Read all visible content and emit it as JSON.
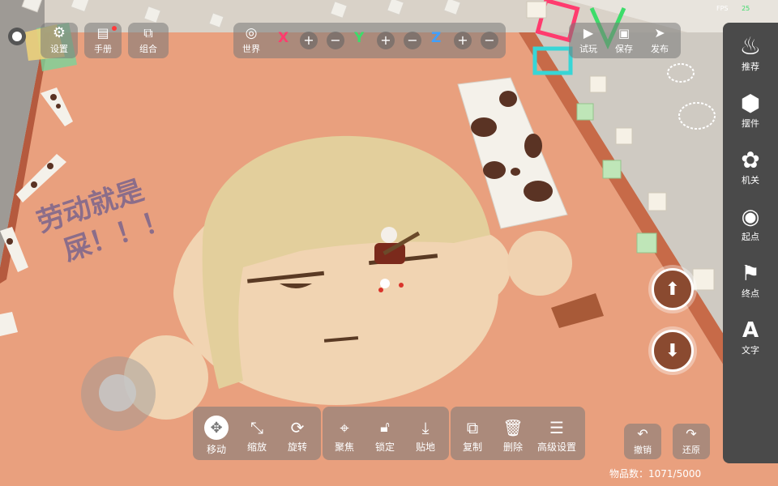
{
  "top_bar": {
    "settings": "设置",
    "manual": "手册",
    "combine": "组合",
    "world": "世界",
    "axis_x": "X",
    "axis_y": "Y",
    "axis_z": "Z",
    "plus": "+",
    "minus": "−",
    "test_play": "试玩",
    "save": "保存",
    "publish": "发布",
    "fps_label": "FPS",
    "fps_value": "25"
  },
  "sidebar": {
    "items": [
      {
        "label": "推荐",
        "icon": "fire-icon"
      },
      {
        "label": "摆件",
        "icon": "cube-icon"
      },
      {
        "label": "机关",
        "icon": "gear-icon"
      },
      {
        "label": "起点",
        "icon": "map-pin-icon"
      },
      {
        "label": "终点",
        "icon": "flag-icon"
      },
      {
        "label": "文字",
        "icon": "text-icon"
      }
    ]
  },
  "bottom_toolbar": {
    "move": "移动",
    "scale": "缩放",
    "rotate": "旋转",
    "focus": "聚焦",
    "lock": "锁定",
    "ground": "贴地",
    "copy": "复制",
    "delete": "删除",
    "advanced": "高级设置"
  },
  "undo": "撤销",
  "redo": "还原",
  "item_count_label": "物品数：",
  "item_count_value": "1071/5000",
  "scene_text": {
    "line1": "劳动就是",
    "line2": "屎！！！"
  },
  "colors": {
    "floor": "#e9a07e",
    "wall": "#b55a3e",
    "axis_x": "#ff3b6e",
    "axis_y": "#3ddc6a",
    "axis_z": "#3fa0ff"
  }
}
